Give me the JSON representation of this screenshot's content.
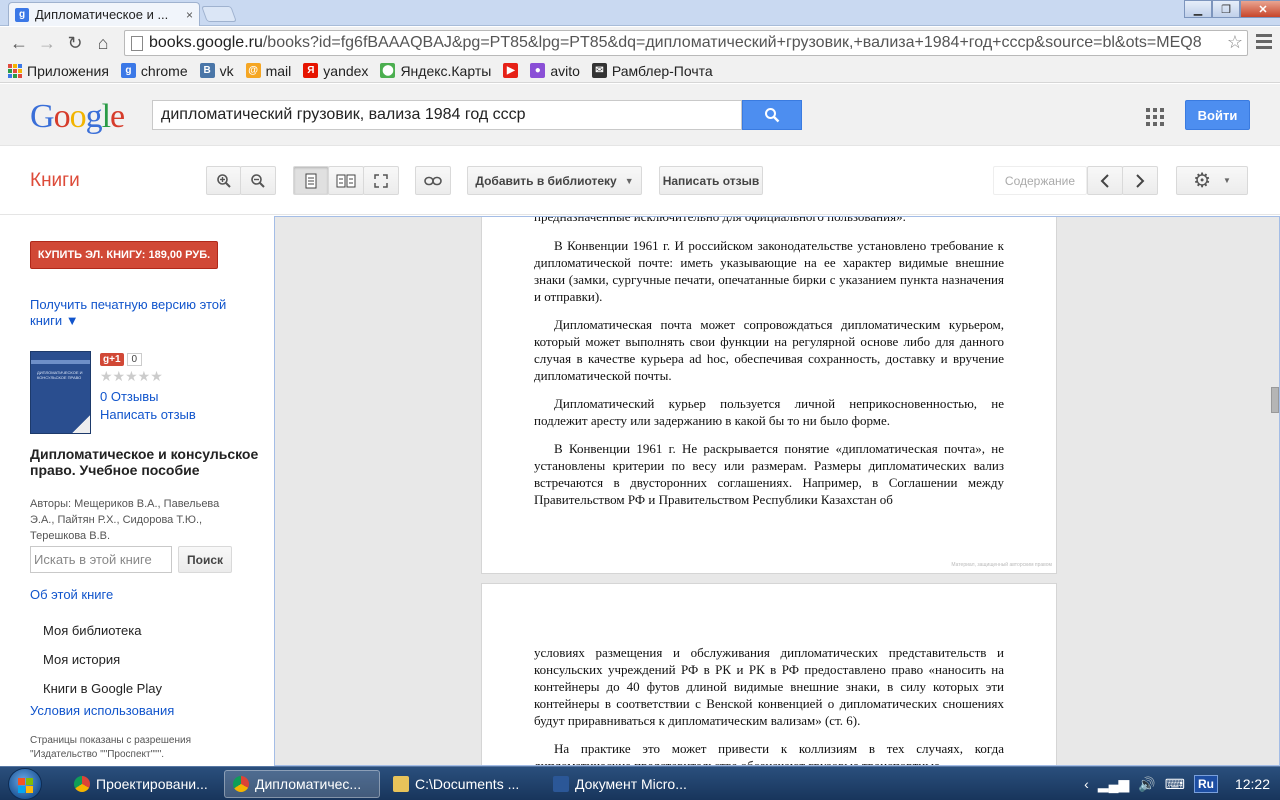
{
  "browser": {
    "tab_title": "Дипломатическое и ...",
    "tab_close": "×",
    "favicon_letter": "g",
    "url_host": "books.google.ru",
    "url_rest": "/books?id=fg6fBAAAQBAJ&pg=PT85&lpg=PT85&dq=дипломатический+грузовик,+вализа+1984+год+ссср&source=bl&ots=MEQ8",
    "window_buttons": [
      "▁",
      "❐",
      "✕"
    ]
  },
  "bookmarks": [
    {
      "label": "Приложения",
      "icon": "apps-icon",
      "color": "#e04a3f"
    },
    {
      "label": "chrome",
      "icon": "google-icon",
      "color": "#3b78e7",
      "glyph": "g"
    },
    {
      "label": "vk",
      "icon": "vk-icon",
      "color": "#4a76a8",
      "glyph": "B"
    },
    {
      "label": "mail",
      "icon": "mail-icon",
      "color": "#f5a623",
      "glyph": "@"
    },
    {
      "label": "yandex",
      "icon": "yandex-icon",
      "color": "#e61400",
      "glyph": "Я"
    },
    {
      "label": "Яндекс.Карты",
      "icon": "maps-icon",
      "color": "#4caf50",
      "glyph": "⬤"
    },
    {
      "label": "",
      "icon": "youtube-icon",
      "color": "#e62117",
      "glyph": "▶"
    },
    {
      "label": "avito",
      "icon": "avito-icon",
      "color": "#8a4fd6",
      "glyph": "●"
    },
    {
      "label": "Рамблер-Почта",
      "icon": "rambler-mail-icon",
      "color": "#333333",
      "glyph": "✉"
    }
  ],
  "google": {
    "search_query": "дипломатический грузовик, вализа 1984 год ссср",
    "signin_label": "Войти"
  },
  "books_toolbar": {
    "title": "Книги",
    "add_to_library": "Добавить в библиотеку",
    "write_review": "Написать отзыв",
    "contents": "Содержание"
  },
  "sidebar": {
    "buy_label": "КУПИТЬ ЭЛ. КНИГУ: 189,00 РУБ.",
    "print_version": "Получить печатную версию этой книги ▼",
    "gplus_label": "g+1",
    "gplus_count": "0",
    "stars": "★★★★★",
    "rating": 0,
    "reviews_count": "0 Отзывы",
    "write_review": "Написать отзыв",
    "book_title": "Дипломатическое и консульское право. Учебное пособие",
    "authors": "Авторы: Мещериков В.А., Павельева Э.А., Пайтян Р.Х., Сидорова Т.Ю., Терешкова В.В.",
    "search_placeholder": "Искать в этой книге",
    "search_button": "Поиск",
    "about": "Об этой книге",
    "nav": [
      "Моя библиотека",
      "Моя история",
      "Книги в Google Play"
    ],
    "terms": "Условия использования",
    "permission": "Страницы показаны с разрешения \"Издательство \"\"Проспект\"\"\"."
  },
  "book_pages": {
    "page1_cut_line": "предназначенные исключительно для официального пользования».",
    "page1_paragraphs": [
      "В Конвенции 1961 г. И российском законодательстве установлено требование к дипломатической почте: иметь указывающие на ее характер видимые внешние знаки (замки, сургучные печати, опечатанные бирки с указанием пункта назначения и отправки).",
      "Дипломатическая почта может сопровождаться дипломатическим курьером, который может выполнять свои функции на регулярной основе либо для данного случая в качестве курьера ad hoc, обеспечивая сохранность, доставку и вручение дипломатической почты.",
      "Дипломатический курьер пользуется личной неприкосновенностью, не подлежит аресту или задержанию в какой бы то ни было форме.",
      "В Конвенции 1961 г. Не раскрывается понятие «дипломатическая почта», не установлены критерии по весу или размерам. Размеры дипломатических вализ встречаются в двусторонних соглашениях. Например, в Соглашении между Правительством РФ и Правительством Республики Казахстан об"
    ],
    "page1_footer": "Материал, защищенный авторским правом",
    "page2_paragraphs": [
      "условиях размещения и обслуживания дипломатических представительств и консульских учреждений РФ в РК и РК в РФ предоставлено право «наносить на контейнеры до 40 футов длиной видимые внешние знаки, в силу которых эти контейнеры в соответствии с Венской конвенцией о дипломатических сношениях будут приравниваться к дипломатическим вализам» (ст. 6).",
      "На практике это может привести к коллизиям в тех случаях, когда дипломатические представительства обозначают грузовые транспортные"
    ]
  },
  "taskbar": {
    "tasks": [
      {
        "label": "Проектировани...",
        "icon": "chrome-icon",
        "active": false
      },
      {
        "label": "Дипломатичес...",
        "icon": "chrome-icon",
        "active": true
      },
      {
        "label": "C:\\Documents ...",
        "icon": "folder-icon",
        "active": false
      },
      {
        "label": "Документ Micro...",
        "icon": "word-icon",
        "active": false
      }
    ],
    "lang": "Ru",
    "clock": "12:22"
  }
}
